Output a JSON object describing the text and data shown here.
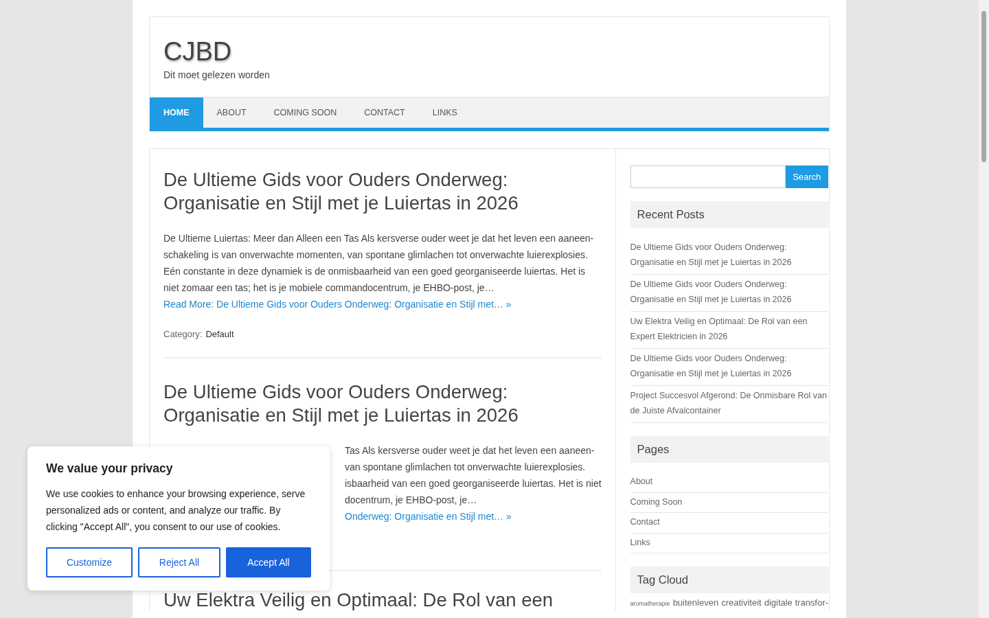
{
  "site": {
    "title": "CJBD",
    "tagline": "Dit moet gelezen worden"
  },
  "nav": [
    {
      "label": "HOME",
      "selected": true
    },
    {
      "label": "ABOUT",
      "selected": false
    },
    {
      "label": "COMING SOON",
      "selected": false
    },
    {
      "label": "CONTACT",
      "selected": false
    },
    {
      "label": "LINKS",
      "selected": false
    }
  ],
  "posts": [
    {
      "title": "De Ultieme Gids voor Ouders Onderweg: Organisatie en Stijl met je Luiertas in 2026",
      "excerpt": "De Ultieme Luiertas: Meer dan Alleen een Tas Als kersverse ouder weet je dat het leven een aaneen-schakeling is van onverwachte momenten, van spontane glimlachen tot onverwachte luierexplosies. Eén constante in deze dynamiek is de onmisbaarheid van een goed georganiseerde luiertas. Het is niet zomaar een tas; het is je mobiele commandocentrum, je EHBO-post, je…",
      "read_more": "Read More: De Ultieme Gids voor Ouders Onderweg: Organisatie en Stijl met… »",
      "category_label": "Category:",
      "category": "Default"
    },
    {
      "title": "De Ultieme Gids voor Ouders Onderweg: Organisatie en Stijl met je Luiertas in 2026",
      "excerpt_lines": [
        "Tas Als kersverse ouder weet je dat het leven een aaneen-",
        "van spontane glimlachen tot onverwachte luierexplosies.",
        "isbaarheid van een goed georganiseerde luiertas. Het is niet",
        "docentrum, je EHBO-post, je…"
      ],
      "read_more": "Onderweg: Organisatie en Stijl met… »"
    },
    {
      "title": "Uw Elektra Veilig en Optimaal: De Rol van een"
    }
  ],
  "sidebar": {
    "search_button": "Search",
    "recent_title": "Recent Posts",
    "recent": [
      "De Ultieme Gids voor Ouders Onderweg: Organisatie en Stijl met je Luiertas in 2026",
      "De Ultieme Gids voor Ouders Onderweg: Organisatie en Stijl met je Luiertas in 2026",
      "Uw Elektra Veilig en Optimaal: De Rol van een Expert Elektricien in 2026",
      "De Ultieme Gids voor Ouders Onderweg: Organisatie en Stijl met je Luiertas in 2026",
      "Project Succesvol Afgerond: De Onmisbare Rol van de Juiste Afvalcontainer"
    ],
    "pages_title": "Pages",
    "pages": [
      "About",
      "Coming Soon",
      "Contact",
      "Links"
    ],
    "tags_title": "Tag Cloud",
    "tags": [
      {
        "label": "aromatherapie",
        "kind": "small"
      },
      {
        "label": "buitenleven",
        "kind": "normal"
      },
      {
        "label": "creativiteit",
        "kind": "normal"
      },
      {
        "label": "digitale transfor-",
        "kind": "normal"
      }
    ]
  },
  "cookie": {
    "title": "We value your privacy",
    "text": "We use cookies to enhance your browsing experience, serve personalized ads or content, and analyze our traffic. By clicking \"Accept All\", you consent to our use of cookies.",
    "buttons": [
      {
        "label": "Customize",
        "kind": "outline"
      },
      {
        "label": "Reject All",
        "kind": "outline"
      },
      {
        "label": "Accept All",
        "kind": "primary"
      }
    ]
  }
}
